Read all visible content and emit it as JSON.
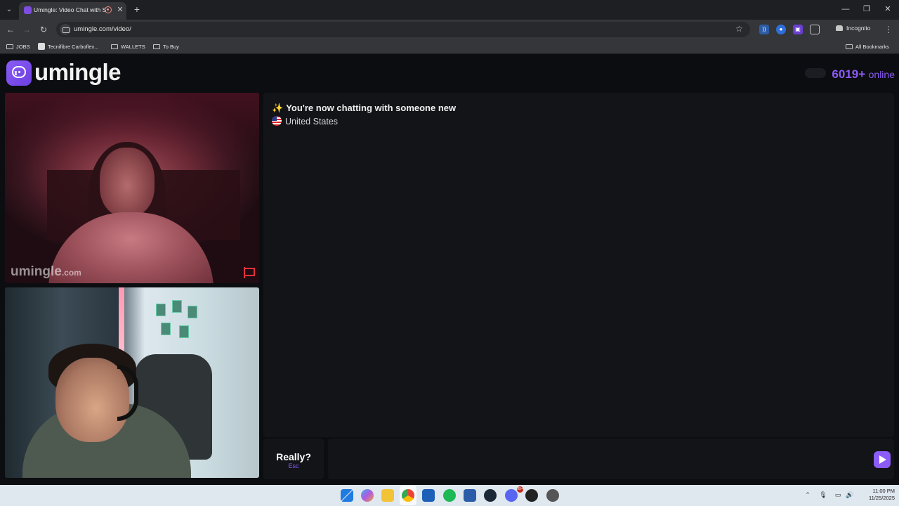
{
  "browser": {
    "tab_title": "Umingle: Video Chat with S",
    "tab_close": "✕",
    "new_tab": "+",
    "url": "umingle.com/video/",
    "profile_label": "Incognito",
    "window_controls": {
      "minimize": "—",
      "restore": "❐",
      "close": "✕"
    },
    "bookmarks": [
      "JOBS",
      "Tecnifibre Carboflex...",
      "WALLETS",
      "To Buy"
    ],
    "all_bookmarks": "All Bookmarks",
    "icons": [
      "tab-menu-icon",
      "back-icon",
      "forward-icon",
      "reload-icon",
      "star-icon",
      "extensions-icon",
      "kebab-menu-icon"
    ]
  },
  "page": {
    "logo_text": "umingle",
    "online_count": "6019+",
    "online_label": "online",
    "watermark_main": "umingle",
    "watermark_suffix": ".com",
    "chat": {
      "system_message": "You're now chatting with someone new",
      "sparkle_glyph": "✨",
      "country": "United States"
    },
    "escape_button": {
      "label": "Really?",
      "hint": "Esc"
    },
    "message_input": {
      "value": "",
      "placeholder": ""
    },
    "accent_color": "#8b5cf6"
  },
  "taskbar": {
    "clock_time": "11:00 PM",
    "clock_date": "11/25/2025",
    "notification_count": "99+"
  }
}
